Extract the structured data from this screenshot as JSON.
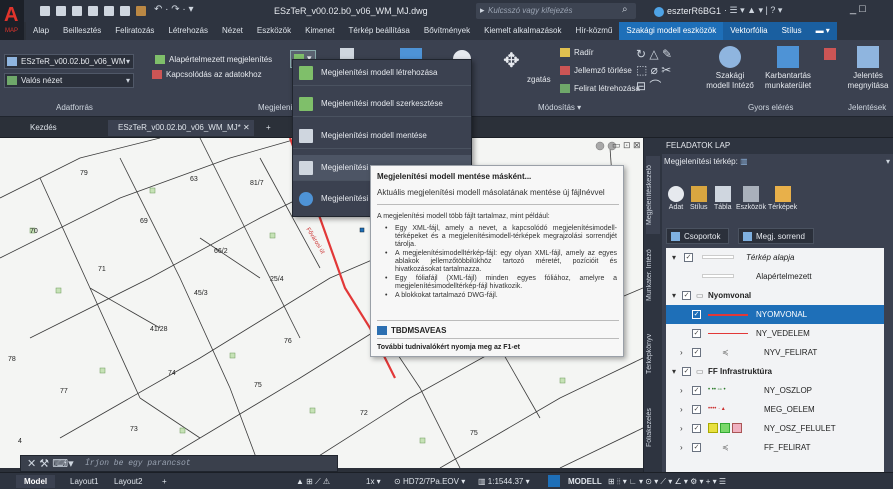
{
  "titlebar": {
    "logo_sub": "MAP",
    "title": "ESzTeR_v00.02.b0_v06_WM_MJ.dwg",
    "search_placeholder": "Kulcsszó vagy kifejezés",
    "user": "eszterR6BG1",
    "window_controls": "_ □"
  },
  "ribbon_tabs": [
    "Alap",
    "Beillesztés",
    "Feliratozás",
    "Létrehozás",
    "Nézet",
    "Eszközök",
    "Kimenet",
    "Térkép beállítása",
    "Bővítmények",
    "Kiemelt alkalmazások",
    "Hír-közmű"
  ],
  "ribbon_ctx_tabs": [
    "Szakági modell eszközök",
    "Vektorfólia",
    "Stílus"
  ],
  "ribbon": {
    "combo1": "ESzTeR_v00.02.b0_v06_WM",
    "combo2": "Valós nézet",
    "combo3": "Alapértelmezett megjelenítés",
    "kapcsolodas": "Kapcsolódás az adatokhoz",
    "panel_adatforras": "Adatforrás",
    "panel_megjelenites": "Megjelenít",
    "radir": "Radír",
    "jellemzo_torlese": "Jellemző törlése",
    "felirat_letrehozasa": "Felirat létrehozása",
    "igazgatas": "zgatás",
    "panel_modositas": "Módosítás",
    "szakagi": "Szakági",
    "szakagi2": "modell Intéző",
    "karbantartas": "Karbantartás",
    "karbantartas2": "munkaterület",
    "jelentes": "Jelentés",
    "jelentes2": "megnyitása",
    "panel_gyors": "Gyors elérés",
    "panel_jelentesek": "Jelentések"
  },
  "doc_tabs": {
    "start": "Kezdés",
    "active": "ESzTeR_v00.02.b0_v06_WM_MJ*",
    "close": "✕",
    "plus": "+"
  },
  "dropdown": {
    "items": [
      "Megjelenítési modell létrehozása",
      "Megjelenítési modell szerkesztése",
      "Megjelenítési modell mentése",
      "Megjelenítési",
      "Megjelenítési"
    ]
  },
  "tooltip": {
    "title": "Megjelenítési modell mentése másként...",
    "desc": "Aktuális megjelenítési modell másolatának mentése új fájlnévvel",
    "para": "A megjelenítési modell több fájlt tartalmaz, mint például:",
    "bullets": [
      "Egy XML-fájl, amely a nevet, a kapcsolódó megjelenítésimodell-térképeket és a megjelenítésimodell-térképek megrajzolási sorrendjét tárolja.",
      "A megjelenítésimodelltérkép-fájl: egy olyan XML-fájl, amely az egyes ablakok jellemzőtöbbilükhöz tartozó méretét, pozícióit és hivatkozásokat tartalmazza.",
      "Egy fóliafájl (XML-fájl) minden egyes fóliához, amelyre a megjelenítésimodelltérkép-fájl hivatkozik.",
      "A blokkokat tartalmazó DWG-fájl."
    ],
    "command": "TBDMSAVEAS",
    "more": "További tudnivalókért nyomja meg az F1-et"
  },
  "map_texts": [
    "79",
    "63",
    "81/7",
    "70",
    "69",
    "71",
    "66/2",
    "41/28",
    "45/3",
    "25/4",
    "78",
    "77",
    "74",
    "75",
    "76",
    "73",
    "4",
    "72",
    "75",
    "Fővárosi út"
  ],
  "cmdline": {
    "placeholder": "Írjon be egy parancsot"
  },
  "statusbar": {
    "tabs": [
      "Model",
      "Layout1",
      "Layout2"
    ],
    "plus": "+",
    "scale_text": "1x",
    "coord": "HD72/7Pa.EOV",
    "ratio": "1:1544.37",
    "model": "MODELL"
  },
  "panel": {
    "title": "FELADATOK LAP",
    "vtabs": [
      "Megjelenítéskezelő",
      "Munkater. Intéző",
      "Térképkönyv",
      "Fóliakezelés"
    ],
    "map_label": "Megjelenítési térkép:",
    "tools": [
      "Adat",
      "Stílus",
      "Tábla",
      "Eszközök",
      "Térképek"
    ],
    "btn_csoportok": "Csoportok",
    "btn_sorrend": "Megj. sorrend",
    "tree": [
      {
        "label": "Térkép alapja",
        "italic": true
      },
      {
        "label": "Alapértelmezett"
      },
      {
        "label": "Nyomvonal",
        "bold": true
      },
      {
        "label": "NYOMVONAL",
        "selected": true
      },
      {
        "label": "NY_VEDELEM"
      },
      {
        "label": "NYV_FELIRAT"
      },
      {
        "label": "FF Infrastruktúra",
        "bold": true
      },
      {
        "label": "NY_OSZLOP"
      },
      {
        "label": "MEG_OELEM"
      },
      {
        "label": "NY_OSZ_FELULET"
      },
      {
        "label": "FF_FELIRAT"
      }
    ]
  },
  "colors": {
    "accent": "#1e6fb8",
    "logo": "#e0342c",
    "road": "#e23838"
  }
}
